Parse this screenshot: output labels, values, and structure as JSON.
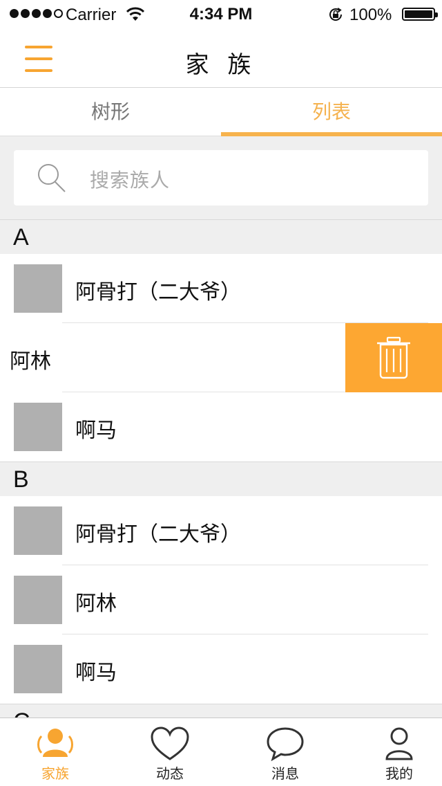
{
  "status_bar": {
    "carrier": "Carrier",
    "time": "4:34 PM",
    "battery": "100%"
  },
  "nav": {
    "title": "家 族",
    "menu_icon": "hamburger-menu-icon"
  },
  "segments": {
    "tree_label": "树形",
    "list_label": "列表",
    "active": "列表"
  },
  "search": {
    "placeholder": "搜索族人",
    "icon": "search-icon"
  },
  "sections": [
    {
      "letter": "A",
      "rows": [
        {
          "name": "阿骨打（二大爷）"
        },
        {
          "name": "阿林",
          "swiped": true,
          "action_icon": "trash-icon"
        },
        {
          "name": "啊马"
        }
      ]
    },
    {
      "letter": "B",
      "rows": [
        {
          "name": "阿骨打（二大爷）"
        },
        {
          "name": "阿林"
        },
        {
          "name": "啊马"
        }
      ]
    },
    {
      "letter": "C",
      "rows": []
    }
  ],
  "tab_bar": {
    "items": [
      {
        "label": "家族",
        "icon": "family-icon",
        "active": true
      },
      {
        "label": "动态",
        "icon": "heart-icon",
        "active": false
      },
      {
        "label": "消息",
        "icon": "chat-bubble-icon",
        "active": false
      },
      {
        "label": "我的",
        "icon": "person-icon",
        "active": false
      }
    ]
  },
  "colors": {
    "accent": "#f7a531",
    "delete": "#fda732",
    "avatar_placeholder": "#b0b0b0"
  }
}
